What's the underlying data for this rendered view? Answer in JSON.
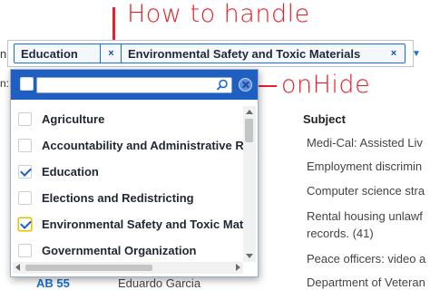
{
  "annotations": {
    "top": "How to handle",
    "right": "onHide",
    "color": "#e8202a"
  },
  "field": {
    "label": "n:",
    "selected_tags": [
      "Education",
      "Environmental Safety and Toxic Materials"
    ],
    "remove_symbol": "×",
    "toggle_symbol": "▼"
  },
  "table": {
    "row_label": "n:",
    "subject_header": "Subject",
    "subjects": [
      "Medi-Cal: Assisted Liv",
      "Employment discrimin",
      "Computer science stra",
      "Rental housing unlawf",
      "records. (41)",
      "Peace officers: video a",
      "Department of Veteran"
    ],
    "bill": "AB 55",
    "author": "Eduardo Garcia"
  },
  "dropdown": {
    "filter_value": "",
    "options": [
      {
        "label": "Agriculture",
        "checked": false
      },
      {
        "label": "Accountability and Administrative Review",
        "checked": false
      },
      {
        "label": "Education",
        "checked": true
      },
      {
        "label": "Elections and Redistricting",
        "checked": false
      },
      {
        "label": "Environmental Safety and Toxic Materials",
        "checked": true
      },
      {
        "label": "Governmental Organization",
        "checked": false
      }
    ],
    "header_color": "#1f5fc2"
  }
}
